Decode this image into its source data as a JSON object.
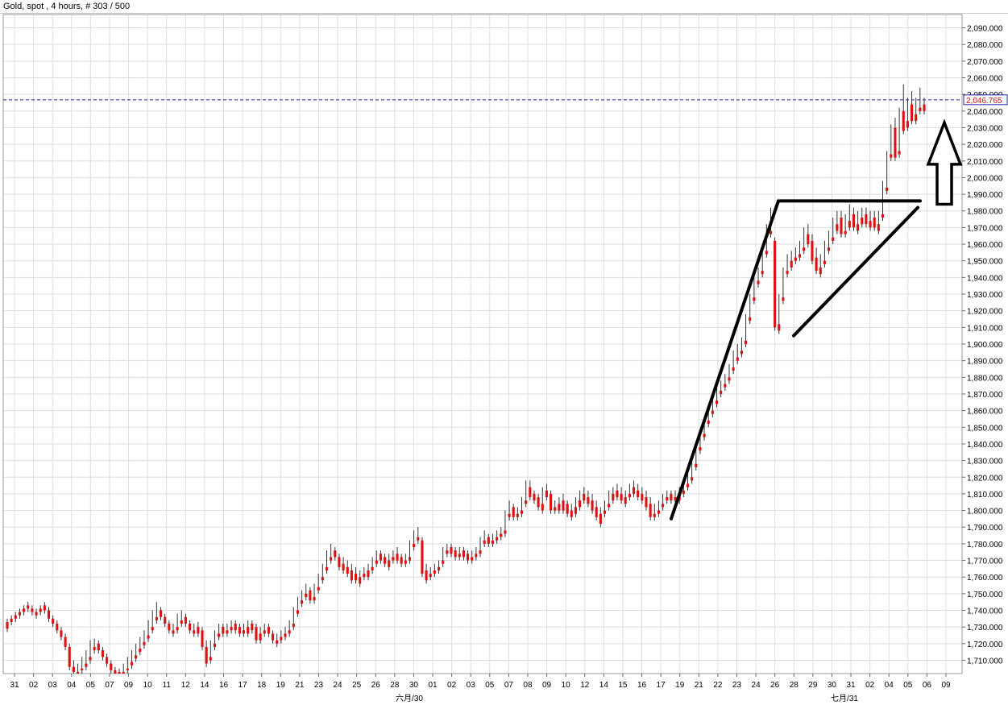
{
  "window": {
    "title": "Gold, spot , 4 hours, # 303 / 500"
  },
  "chart_data": {
    "type": "candlestick",
    "title": "Gold, spot , 4 hours, # 303 / 500",
    "ylim": [
      1702,
      2098
    ],
    "grid": true,
    "y_ticks": [
      "1,710.000",
      "1,720.000",
      "1,730.000",
      "1,740.000",
      "1,750.000",
      "1,760.000",
      "1,770.000",
      "1,780.000",
      "1,790.000",
      "1,800.000",
      "1,810.000",
      "1,820.000",
      "1,830.000",
      "1,840.000",
      "1,850.000",
      "1,860.000",
      "1,870.000",
      "1,880.000",
      "1,890.000",
      "1,900.000",
      "1,910.000",
      "1,920.000",
      "1,930.000",
      "1,940.000",
      "1,950.000",
      "1,960.000",
      "1,970.000",
      "1,980.000",
      "1,990.000",
      "2,000.000",
      "2,010.000",
      "2,020.000",
      "2,030.000",
      "2,040.000",
      "2,050.000",
      "2,060.000",
      "2,070.000",
      "2,080.000",
      "2,090.000"
    ],
    "x_ticks": [
      "31",
      "02",
      "03",
      "04",
      "05",
      "07",
      "09",
      "10",
      "11",
      "12",
      "14",
      "16",
      "17",
      "18",
      "19",
      "21",
      "23",
      "24",
      "25",
      "26",
      "28",
      "30",
      "01",
      "02",
      "03",
      "05",
      "07",
      "08",
      "09",
      "10",
      "12",
      "14",
      "15",
      "16",
      "17",
      "19",
      "21",
      "22",
      "23",
      "24",
      "26",
      "28",
      "29",
      "30",
      "31",
      "02",
      "04",
      "05",
      "06",
      "09"
    ],
    "month_labels": [
      "六月/30",
      "七月/31"
    ],
    "current_price": {
      "label": "2,046.765",
      "value": 2046.765
    },
    "colors": {
      "up": "#1f1fd6",
      "down": "#dd1111",
      "grid": "#dedede",
      "price_line": "#2323a8"
    },
    "candles": [
      [
        1733,
        1735,
        1729,
        1727
      ],
      [
        1735,
        1737,
        1733,
        1731
      ],
      [
        1737,
        1739,
        1735,
        1733
      ],
      [
        1739,
        1741,
        1737,
        1735
      ],
      [
        1741,
        1743,
        1739,
        1737
      ],
      [
        1743,
        1745,
        1741,
        1739
      ],
      [
        1741,
        1743,
        1739,
        1737
      ],
      [
        1739,
        1741,
        1737,
        1735
      ],
      [
        1741,
        1743,
        1739,
        1737
      ],
      [
        1743,
        1745,
        1740,
        1738
      ],
      [
        1740,
        1742,
        1735,
        1733
      ],
      [
        1735,
        1737,
        1732,
        1730
      ],
      [
        1732,
        1734,
        1728,
        1726
      ],
      [
        1728,
        1730,
        1724,
        1722
      ],
      [
        1724,
        1726,
        1718,
        1716
      ],
      [
        1718,
        1720,
        1706,
        1704
      ],
      [
        1706,
        1710,
        1703,
        1702
      ],
      [
        1703,
        1708,
        1702,
        1702
      ],
      [
        1705,
        1712,
        1704,
        1702
      ],
      [
        1708,
        1716,
        1706,
        1704
      ],
      [
        1712,
        1722,
        1710,
        1708
      ],
      [
        1718,
        1723,
        1716,
        1714
      ],
      [
        1720,
        1722,
        1716,
        1714
      ],
      [
        1716,
        1718,
        1712,
        1710
      ],
      [
        1712,
        1714,
        1708,
        1706
      ],
      [
        1708,
        1710,
        1704,
        1702
      ],
      [
        1704,
        1706,
        1702,
        1702
      ],
      [
        1703,
        1705,
        1702,
        1702
      ],
      [
        1703,
        1708,
        1702,
        1702
      ],
      [
        1705,
        1712,
        1704,
        1702
      ],
      [
        1709,
        1716,
        1707,
        1705
      ],
      [
        1713,
        1720,
        1711,
        1709
      ],
      [
        1717,
        1724,
        1715,
        1713
      ],
      [
        1721,
        1728,
        1719,
        1717
      ],
      [
        1725,
        1734,
        1723,
        1721
      ],
      [
        1730,
        1740,
        1728,
        1726
      ],
      [
        1736,
        1745,
        1734,
        1732
      ],
      [
        1740,
        1742,
        1736,
        1734
      ],
      [
        1736,
        1738,
        1732,
        1730
      ],
      [
        1732,
        1734,
        1728,
        1726
      ],
      [
        1728,
        1732,
        1726,
        1724
      ],
      [
        1730,
        1738,
        1728,
        1726
      ],
      [
        1734,
        1740,
        1732,
        1730
      ],
      [
        1736,
        1738,
        1732,
        1730
      ],
      [
        1732,
        1734,
        1728,
        1726
      ],
      [
        1728,
        1732,
        1726,
        1724
      ],
      [
        1730,
        1733,
        1726,
        1724
      ],
      [
        1728,
        1730,
        1718,
        1716
      ],
      [
        1718,
        1722,
        1708,
        1706
      ],
      [
        1712,
        1722,
        1710,
        1708
      ],
      [
        1720,
        1728,
        1718,
        1716
      ],
      [
        1726,
        1732,
        1724,
        1722
      ],
      [
        1730,
        1732,
        1726,
        1724
      ],
      [
        1728,
        1732,
        1726,
        1724
      ],
      [
        1730,
        1734,
        1728,
        1726
      ],
      [
        1732,
        1734,
        1728,
        1726
      ],
      [
        1730,
        1732,
        1726,
        1724
      ],
      [
        1728,
        1732,
        1726,
        1724
      ],
      [
        1730,
        1734,
        1726,
        1724
      ],
      [
        1732,
        1734,
        1728,
        1726
      ],
      [
        1730,
        1732,
        1722,
        1720
      ],
      [
        1726,
        1730,
        1722,
        1720
      ],
      [
        1728,
        1732,
        1726,
        1724
      ],
      [
        1730,
        1732,
        1726,
        1724
      ],
      [
        1726,
        1728,
        1722,
        1720
      ],
      [
        1722,
        1726,
        1720,
        1718
      ],
      [
        1724,
        1728,
        1722,
        1720
      ],
      [
        1726,
        1730,
        1724,
        1722
      ],
      [
        1728,
        1734,
        1726,
        1724
      ],
      [
        1732,
        1742,
        1730,
        1728
      ],
      [
        1740,
        1748,
        1738,
        1736
      ],
      [
        1746,
        1752,
        1744,
        1742
      ],
      [
        1750,
        1756,
        1748,
        1746
      ],
      [
        1752,
        1754,
        1746,
        1744
      ],
      [
        1748,
        1756,
        1746,
        1744
      ],
      [
        1754,
        1762,
        1752,
        1750
      ],
      [
        1760,
        1768,
        1758,
        1756
      ],
      [
        1766,
        1776,
        1764,
        1762
      ],
      [
        1772,
        1780,
        1770,
        1768
      ],
      [
        1776,
        1778,
        1772,
        1770
      ],
      [
        1772,
        1774,
        1766,
        1764
      ],
      [
        1768,
        1772,
        1764,
        1762
      ],
      [
        1766,
        1770,
        1762,
        1760
      ],
      [
        1764,
        1768,
        1758,
        1756
      ],
      [
        1762,
        1766,
        1758,
        1756
      ],
      [
        1760,
        1764,
        1756,
        1754
      ],
      [
        1762,
        1766,
        1760,
        1758
      ],
      [
        1764,
        1768,
        1760,
        1758
      ],
      [
        1766,
        1772,
        1764,
        1762
      ],
      [
        1770,
        1776,
        1768,
        1766
      ],
      [
        1774,
        1776,
        1770,
        1768
      ],
      [
        1772,
        1774,
        1768,
        1766
      ],
      [
        1770,
        1774,
        1766,
        1764
      ],
      [
        1772,
        1776,
        1770,
        1768
      ],
      [
        1774,
        1778,
        1770,
        1768
      ],
      [
        1772,
        1774,
        1768,
        1766
      ],
      [
        1770,
        1774,
        1768,
        1766
      ],
      [
        1772,
        1782,
        1770,
        1768
      ],
      [
        1780,
        1788,
        1778,
        1776
      ],
      [
        1784,
        1790,
        1782,
        1780
      ],
      [
        1782,
        1784,
        1762,
        1760
      ],
      [
        1764,
        1768,
        1758,
        1756
      ],
      [
        1762,
        1766,
        1760,
        1758
      ],
      [
        1764,
        1768,
        1762,
        1760
      ],
      [
        1766,
        1770,
        1764,
        1762
      ],
      [
        1770,
        1778,
        1768,
        1766
      ],
      [
        1776,
        1780,
        1774,
        1772
      ],
      [
        1778,
        1780,
        1774,
        1772
      ],
      [
        1776,
        1778,
        1772,
        1770
      ],
      [
        1774,
        1778,
        1772,
        1770
      ],
      [
        1776,
        1778,
        1772,
        1770
      ],
      [
        1774,
        1776,
        1770,
        1768
      ],
      [
        1772,
        1776,
        1770,
        1768
      ],
      [
        1774,
        1778,
        1772,
        1770
      ],
      [
        1776,
        1784,
        1774,
        1772
      ],
      [
        1782,
        1788,
        1780,
        1778
      ],
      [
        1784,
        1786,
        1780,
        1778
      ],
      [
        1782,
        1786,
        1780,
        1778
      ],
      [
        1784,
        1788,
        1782,
        1780
      ],
      [
        1786,
        1790,
        1784,
        1782
      ],
      [
        1788,
        1800,
        1786,
        1784
      ],
      [
        1798,
        1806,
        1796,
        1794
      ],
      [
        1802,
        1804,
        1796,
        1794
      ],
      [
        1798,
        1802,
        1796,
        1794
      ],
      [
        1800,
        1808,
        1798,
        1796
      ],
      [
        1806,
        1818,
        1804,
        1802
      ],
      [
        1814,
        1818,
        1808,
        1806
      ],
      [
        1810,
        1812,
        1806,
        1804
      ],
      [
        1808,
        1810,
        1802,
        1800
      ],
      [
        1804,
        1814,
        1800,
        1798
      ],
      [
        1812,
        1816,
        1808,
        1806
      ],
      [
        1810,
        1812,
        1800,
        1798
      ],
      [
        1802,
        1806,
        1800,
        1798
      ],
      [
        1804,
        1808,
        1800,
        1798
      ],
      [
        1806,
        1810,
        1800,
        1798
      ],
      [
        1804,
        1806,
        1798,
        1796
      ],
      [
        1800,
        1804,
        1796,
        1794
      ],
      [
        1802,
        1808,
        1798,
        1796
      ],
      [
        1806,
        1812,
        1802,
        1800
      ],
      [
        1810,
        1814,
        1806,
        1804
      ],
      [
        1808,
        1812,
        1804,
        1802
      ],
      [
        1806,
        1810,
        1800,
        1798
      ],
      [
        1802,
        1806,
        1796,
        1794
      ],
      [
        1798,
        1802,
        1792,
        1790
      ],
      [
        1800,
        1806,
        1798,
        1796
      ],
      [
        1804,
        1812,
        1802,
        1800
      ],
      [
        1810,
        1814,
        1806,
        1804
      ],
      [
        1812,
        1816,
        1808,
        1806
      ],
      [
        1810,
        1814,
        1806,
        1804
      ],
      [
        1808,
        1812,
        1804,
        1802
      ],
      [
        1810,
        1816,
        1808,
        1806
      ],
      [
        1814,
        1818,
        1810,
        1808
      ],
      [
        1812,
        1816,
        1808,
        1806
      ],
      [
        1810,
        1814,
        1806,
        1804
      ],
      [
        1808,
        1812,
        1802,
        1800
      ],
      [
        1804,
        1808,
        1796,
        1794
      ],
      [
        1798,
        1804,
        1796,
        1794
      ],
      [
        1800,
        1806,
        1798,
        1796
      ],
      [
        1804,
        1810,
        1802,
        1800
      ],
      [
        1808,
        1812,
        1806,
        1804
      ],
      [
        1810,
        1812,
        1806,
        1804
      ],
      [
        1808,
        1812,
        1806,
        1804
      ],
      [
        1810,
        1814,
        1806,
        1804
      ],
      [
        1812,
        1818,
        1810,
        1808
      ],
      [
        1816,
        1822,
        1814,
        1812
      ],
      [
        1820,
        1830,
        1818,
        1816
      ],
      [
        1828,
        1840,
        1826,
        1824
      ],
      [
        1838,
        1848,
        1836,
        1834
      ],
      [
        1846,
        1856,
        1844,
        1842
      ],
      [
        1854,
        1862,
        1852,
        1850
      ],
      [
        1860,
        1868,
        1858,
        1856
      ],
      [
        1866,
        1874,
        1864,
        1862
      ],
      [
        1872,
        1878,
        1870,
        1868
      ],
      [
        1876,
        1882,
        1874,
        1872
      ],
      [
        1880,
        1888,
        1878,
        1876
      ],
      [
        1886,
        1896,
        1884,
        1882
      ],
      [
        1892,
        1900,
        1890,
        1888
      ],
      [
        1896,
        1904,
        1894,
        1892
      ],
      [
        1902,
        1918,
        1900,
        1898
      ],
      [
        1916,
        1930,
        1914,
        1912
      ],
      [
        1928,
        1940,
        1926,
        1924
      ],
      [
        1938,
        1946,
        1936,
        1934
      ],
      [
        1944,
        1958,
        1942,
        1940
      ],
      [
        1956,
        1972,
        1954,
        1952
      ],
      [
        1968,
        1982,
        1966,
        1964
      ],
      [
        1962,
        1964,
        1910,
        1908
      ],
      [
        1912,
        1930,
        1908,
        1906
      ],
      [
        1928,
        1946,
        1926,
        1924
      ],
      [
        1944,
        1954,
        1942,
        1940
      ],
      [
        1950,
        1956,
        1946,
        1944
      ],
      [
        1952,
        1958,
        1950,
        1948
      ],
      [
        1954,
        1962,
        1952,
        1950
      ],
      [
        1958,
        1970,
        1956,
        1954
      ],
      [
        1966,
        1972,
        1960,
        1958
      ],
      [
        1962,
        1966,
        1950,
        1948
      ],
      [
        1952,
        1958,
        1944,
        1942
      ],
      [
        1946,
        1954,
        1942,
        1940
      ],
      [
        1950,
        1962,
        1948,
        1946
      ],
      [
        1958,
        1968,
        1956,
        1954
      ],
      [
        1964,
        1976,
        1962,
        1960
      ],
      [
        1972,
        1980,
        1968,
        1966
      ],
      [
        1976,
        1980,
        1966,
        1964
      ],
      [
        1968,
        1978,
        1966,
        1964
      ],
      [
        1974,
        1984,
        1970,
        1968
      ],
      [
        1978,
        1982,
        1970,
        1968
      ],
      [
        1972,
        1980,
        1968,
        1966
      ],
      [
        1976,
        1982,
        1972,
        1970
      ],
      [
        1978,
        1982,
        1972,
        1970
      ],
      [
        1974,
        1980,
        1970,
        1968
      ],
      [
        1976,
        1980,
        1970,
        1968
      ],
      [
        1972,
        1980,
        1968,
        1966
      ],
      [
        1978,
        1998,
        1976,
        1974
      ],
      [
        1994,
        2016,
        1992,
        1990
      ],
      [
        2014,
        2032,
        2012,
        2010
      ],
      [
        2030,
        2036,
        2012,
        2010
      ],
      [
        2016,
        2042,
        2014,
        2012
      ],
      [
        2040,
        2056,
        2028,
        2026
      ],
      [
        2034,
        2048,
        2030,
        2028
      ],
      [
        2044,
        2052,
        2034,
        2032
      ],
      [
        2038,
        2048,
        2034,
        2032
      ],
      [
        2042,
        2054,
        2040,
        2038
      ],
      [
        2044,
        2048,
        2040,
        2038
      ]
    ],
    "annotations": [
      {
        "type": "trendline",
        "description": "flagpole"
      },
      {
        "type": "trendline",
        "description": "flag top"
      },
      {
        "type": "trendline",
        "description": "flag bottom"
      },
      {
        "type": "arrow",
        "description": "up arrow"
      }
    ]
  }
}
